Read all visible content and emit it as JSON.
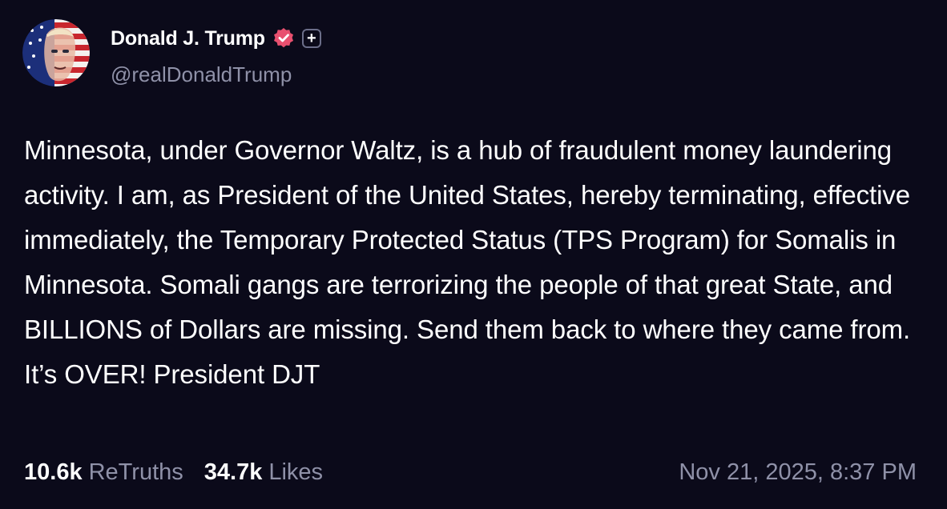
{
  "author": {
    "display_name": "Donald J. Trump",
    "handle": "@realDonaldTrump",
    "verified_icon": "verified-badge-icon",
    "plus_badge": "+"
  },
  "post": {
    "text": "Minnesota, under Governor Waltz, is a hub of fraudulent money laundering activity. I am, as President of the United States, hereby terminating, effective immediately, the Temporary Protected Status (TPS Program) for Somalis in Minnesota. Somali gangs are terrorizing the people of that great State, and BILLIONS of Dollars are missing. Send them back to where they came from. It’s OVER! President DJT"
  },
  "stats": {
    "retruths_count": "10.6k",
    "retruths_label": "ReTruths",
    "likes_count": "34.7k",
    "likes_label": "Likes"
  },
  "timestamp": "Nov 21, 2025, 8:37 PM",
  "colors": {
    "background": "#0b0a1a",
    "text_primary": "#ffffff",
    "text_secondary": "#8f91a8",
    "verified": "#e8506f"
  }
}
